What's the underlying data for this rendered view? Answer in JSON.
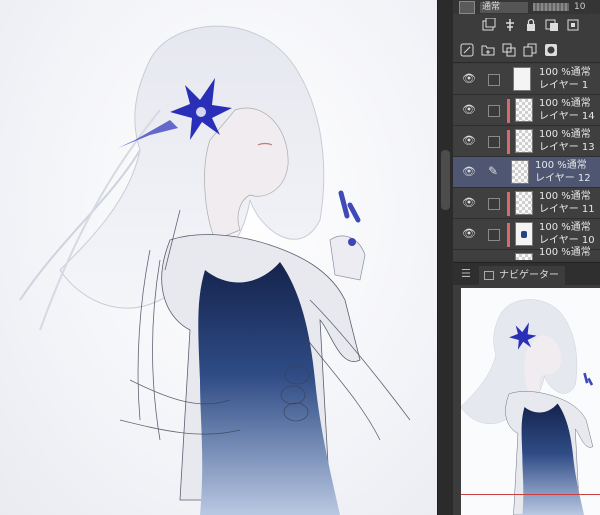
{
  "toolbar": {
    "blend_mode": "通常",
    "opacity_partial": "10"
  },
  "icons_row1": [
    "new-layer-icon",
    "transfer-icon",
    "lock-icon",
    "clip-icon",
    "reference-icon"
  ],
  "icons_row2": [
    "new-raster-icon",
    "new-folder-icon",
    "merge-icon",
    "copy-icon",
    "mask-icon"
  ],
  "layers": [
    {
      "blend": "100 %通常",
      "name": "レイヤー 1",
      "visible": true,
      "selected": false,
      "clipped": false,
      "thumb": "plain"
    },
    {
      "blend": "100 %通常",
      "name": "レイヤー 14",
      "visible": true,
      "selected": false,
      "clipped": true,
      "thumb": "check"
    },
    {
      "blend": "100 %通常",
      "name": "レイヤー 13",
      "visible": true,
      "selected": false,
      "clipped": true,
      "thumb": "check"
    },
    {
      "blend": "100 %通常",
      "name": "レイヤー 12",
      "visible": true,
      "selected": true,
      "clipped": false,
      "thumb": "check"
    },
    {
      "blend": "100 %通常",
      "name": "レイヤー 11",
      "visible": true,
      "selected": false,
      "clipped": true,
      "thumb": "check"
    },
    {
      "blend": "100 %通常",
      "name": "レイヤー 10",
      "visible": true,
      "selected": false,
      "clipped": true,
      "thumb": "dot"
    },
    {
      "blend": "100 %通常",
      "name": "",
      "visible": true,
      "selected": false,
      "clipped": false,
      "thumb": "check"
    }
  ],
  "navigator": {
    "tab_label": "ナビゲーター",
    "menu_icon": "hamburger-icon"
  },
  "colors": {
    "selected_layer": "#4e5672",
    "clip_marker": "#d96a6a",
    "dress_dark": "#1d2a55",
    "flower_blue": "#2a2fb8"
  }
}
